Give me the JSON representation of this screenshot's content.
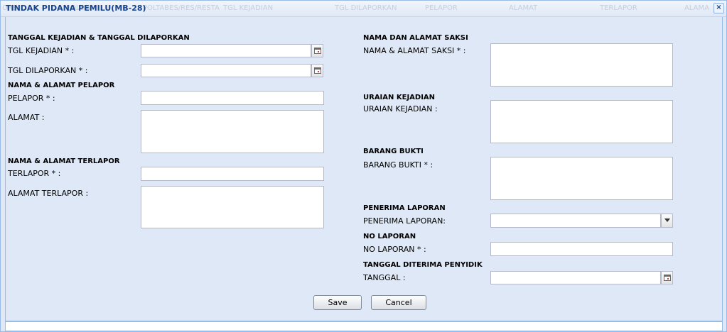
{
  "window": {
    "title": "TINDAK PIDANA PEMILU(MB-28)",
    "background_columns": [
      "ORS",
      "POLDA",
      "POLTABES/RES/RESTA",
      "TGL KEJADIAN",
      "TGL DILAPORKAN",
      "PELAPOR",
      "ALAMAT",
      "TERLAPOR",
      "ALAMA"
    ],
    "close_glyph": "×"
  },
  "left": {
    "sec_kejadian": "TANGGAL KEJADIAN & TANGGAL DILAPORKAN",
    "tgl_kejadian_label": "TGL KEJADIAN * :",
    "tgl_kejadian_value": "",
    "tgl_dilaporkan_label": "TGL DILAPORKAN * :",
    "tgl_dilaporkan_value": "",
    "sec_pelapor": "NAMA & ALAMAT PELAPOR",
    "pelapor_label": "PELAPOR * :",
    "pelapor_value": "",
    "alamat_label": "ALAMAT :",
    "alamat_value": "",
    "sec_terlapor": "NAMA & ALAMAT TERLAPOR",
    "terlapor_label": "TERLAPOR * :",
    "terlapor_value": "",
    "alamat_terlapor_label": "ALAMAT TERLAPOR :",
    "alamat_terlapor_value": ""
  },
  "right": {
    "sec_saksi": "NAMA DAN ALAMAT SAKSI",
    "saksi_label": "NAMA & ALAMAT SAKSI * :",
    "saksi_value": "",
    "sec_uraian": "URAIAN KEJADIAN",
    "uraian_label": "URAIAN KEJADIAN :",
    "uraian_value": "",
    "sec_bukti": "BARANG BUKTI",
    "bukti_label": "BARANG BUKTI * :",
    "bukti_value": "",
    "sec_penerima": "PENERIMA LAPORAN",
    "penerima_label": "PENERIMA LAPORAN:",
    "penerima_value": "",
    "sec_no": "NO LAPORAN",
    "no_label": "NO LAPORAN * :",
    "no_value": "",
    "sec_tanggal": "TANGGAL DITERIMA PENYIDIK",
    "tanggal_label": "TANGGAL :",
    "tanggal_value": ""
  },
  "buttons": {
    "save": "Save",
    "cancel": "Cancel"
  },
  "colors": {
    "title_text": "#15428b",
    "panel_bg": "#dfe8f6",
    "border": "#99bbe8"
  },
  "icons": {
    "date_trigger": "calendar-icon",
    "combo_trigger": "chevron-down-icon",
    "close": "close-icon"
  }
}
